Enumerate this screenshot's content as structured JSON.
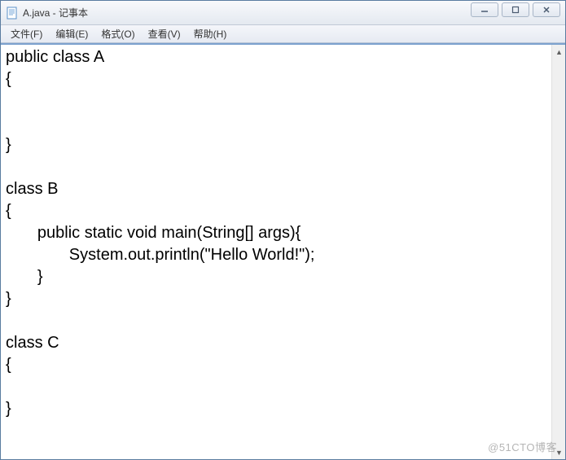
{
  "window": {
    "title": "A.java - 记事本"
  },
  "menubar": {
    "items": [
      {
        "label": "文件(F)"
      },
      {
        "label": "编辑(E)"
      },
      {
        "label": "格式(O)"
      },
      {
        "label": "查看(V)"
      },
      {
        "label": "帮助(H)"
      }
    ]
  },
  "editor": {
    "content": "public class A\n{\n\n\n}\n\nclass B\n{\n       public static void main(String[] args){\n              System.out.println(\"Hello World!\");\n       }\n}\n\nclass C\n{\n\n}"
  },
  "watermark": "@51CTO博客"
}
